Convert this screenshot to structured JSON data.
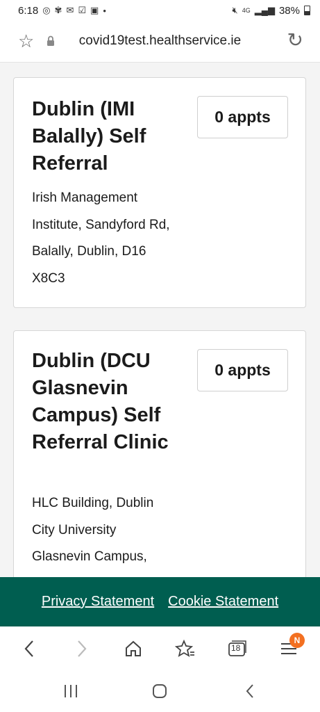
{
  "status_bar": {
    "time": "6:18",
    "network": "4G",
    "battery": "38%"
  },
  "url_bar": {
    "url": "covid19test.healthservice.ie"
  },
  "cards": [
    {
      "title": "Dublin (IMI Balally) Self Referral",
      "address": "Irish Management Institute, Sandyford Rd, Balally, Dublin, D16 X8C3",
      "appointments": "0 appts"
    },
    {
      "title": "Dublin (DCU Glasnevin Campus) Self Referral Clinic",
      "address": "HLC Building, Dublin City University Glasnevin Campus,",
      "appointments": "0 appts"
    }
  ],
  "footer": {
    "privacy": "Privacy Statement",
    "cookie": "Cookie Statement"
  },
  "browser_toolbar": {
    "tabs_count": "18",
    "menu_badge": "N",
    "badge_color": "#f37021"
  },
  "colors": {
    "footer_bg": "#005e50"
  }
}
